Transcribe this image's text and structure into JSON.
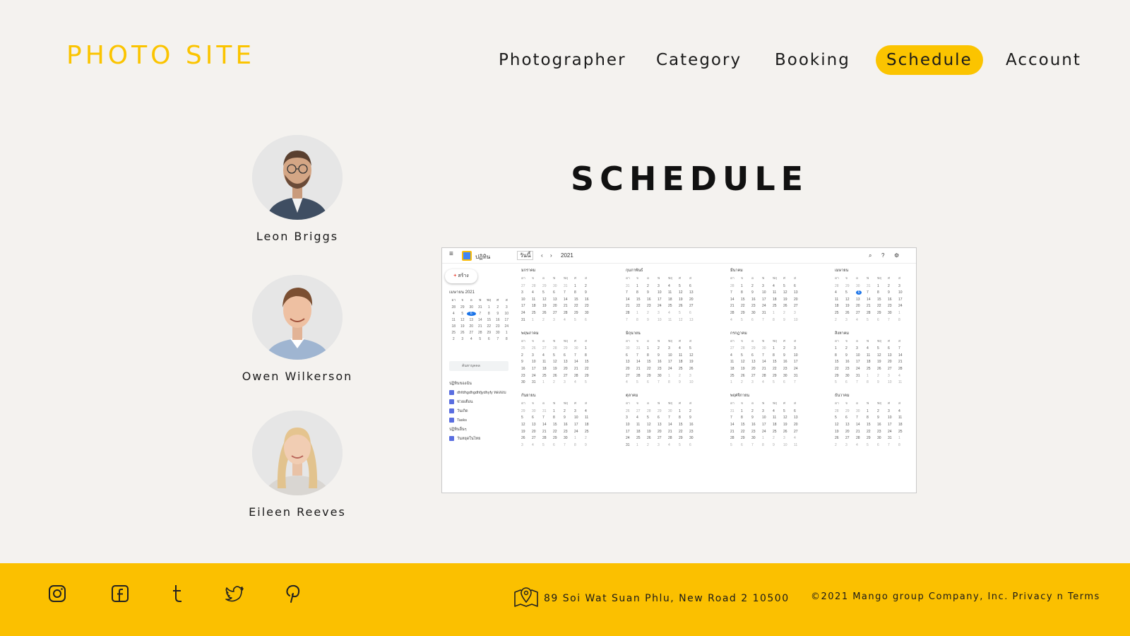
{
  "header": {
    "logo": "PHOTO SITE",
    "nav": [
      "Photographer",
      "Category",
      "Booking",
      "Schedule",
      "Account"
    ],
    "active_nav": "Schedule"
  },
  "photographers": [
    {
      "name": "Leon Briggs"
    },
    {
      "name": "Owen Wilkerson"
    },
    {
      "name": "Eileen Reeves"
    }
  ],
  "main": {
    "title": "SCHEDULE"
  },
  "calendar_screenshot": {
    "app_name": "ปฏิทิน",
    "view": "วันนี้",
    "year": "2021",
    "create_label": "สร้าง",
    "mini_month": "เมษายน 2021",
    "search_people": "ค้นหาบุคคล",
    "my_calendars_label": "ปฏิทินของฉัน",
    "my_calendars": [
      "dhfdhgdhgdhfjydhyfy ทดสอบ",
      "ช่วยเตือน",
      "วันเกิด",
      "Tasks"
    ],
    "other_calendars_label": "ปฏิทินอื่นๆ",
    "other_calendars": [
      "วันหยุดในไทย"
    ],
    "months": [
      "มกราคม",
      "กุมภาพันธ์",
      "มีนาคม",
      "เมษายน",
      "พฤษภาคม",
      "มิถุนายน",
      "กรกฎาคม",
      "สิงหาคม",
      "กันยายน",
      "ตุลาคม",
      "พฤศจิกายน",
      "ธันวาคม"
    ],
    "weekday_headers": [
      "อา",
      "จ",
      "อ",
      "พ",
      "พฤ",
      "ศ",
      "ส"
    ],
    "highlight_month": "เมษายน",
    "highlight_day": "6"
  },
  "footer": {
    "address": "89 Soi Wat Suan Phlu, New Road 2 10500",
    "copyright": "©2021 Mango group Company, Inc.",
    "privacy": "Privacy n Terms"
  },
  "colors": {
    "accent": "#fbc400",
    "background": "#f4f2ef",
    "footer": "#fbc000",
    "calendar_today": "#1a73e8"
  },
  "icons": [
    "instagram-icon",
    "facebook-icon",
    "tumblr-icon",
    "twitter-icon",
    "pinterest-icon",
    "map-pin-icon"
  ]
}
